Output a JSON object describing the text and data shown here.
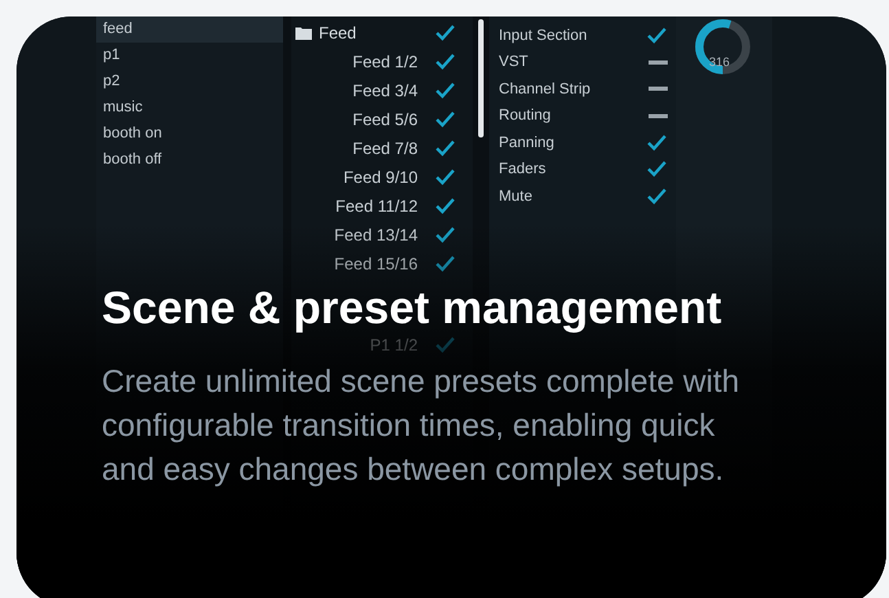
{
  "scenes": [
    {
      "label": "feed",
      "selected": true
    },
    {
      "label": "p1",
      "selected": false
    },
    {
      "label": "p2",
      "selected": false
    },
    {
      "label": "music",
      "selected": false
    },
    {
      "label": "booth on",
      "selected": false
    },
    {
      "label": "booth off",
      "selected": false
    }
  ],
  "preset_folder": {
    "label": "Feed",
    "checked": true
  },
  "presets": [
    {
      "label": "Feed 1/2",
      "checked": true
    },
    {
      "label": "Feed 3/4",
      "checked": true
    },
    {
      "label": "Feed 5/6",
      "checked": true
    },
    {
      "label": "Feed 7/8",
      "checked": true
    },
    {
      "label": "Feed 9/10",
      "checked": true
    },
    {
      "label": "Feed 11/12",
      "checked": true
    },
    {
      "label": "Feed 13/14",
      "checked": true
    },
    {
      "label": "Feed 15/16",
      "checked": true
    },
    {
      "label": "P1 1/2",
      "checked": true
    }
  ],
  "sections": [
    {
      "label": "Input Section",
      "checked": true
    },
    {
      "label": "VST",
      "checked": false
    },
    {
      "label": "Channel Strip",
      "checked": false
    },
    {
      "label": "Routing",
      "checked": false
    },
    {
      "label": "Panning",
      "checked": true
    },
    {
      "label": "Faders",
      "checked": true
    },
    {
      "label": "Mute",
      "checked": true
    }
  ],
  "dial": {
    "level": 0.55,
    "reading": "316"
  },
  "title": "Scene & preset management",
  "description": "Create unlimited scene presets complete with configurable transition times, enabling quick and easy changes between complex setups."
}
